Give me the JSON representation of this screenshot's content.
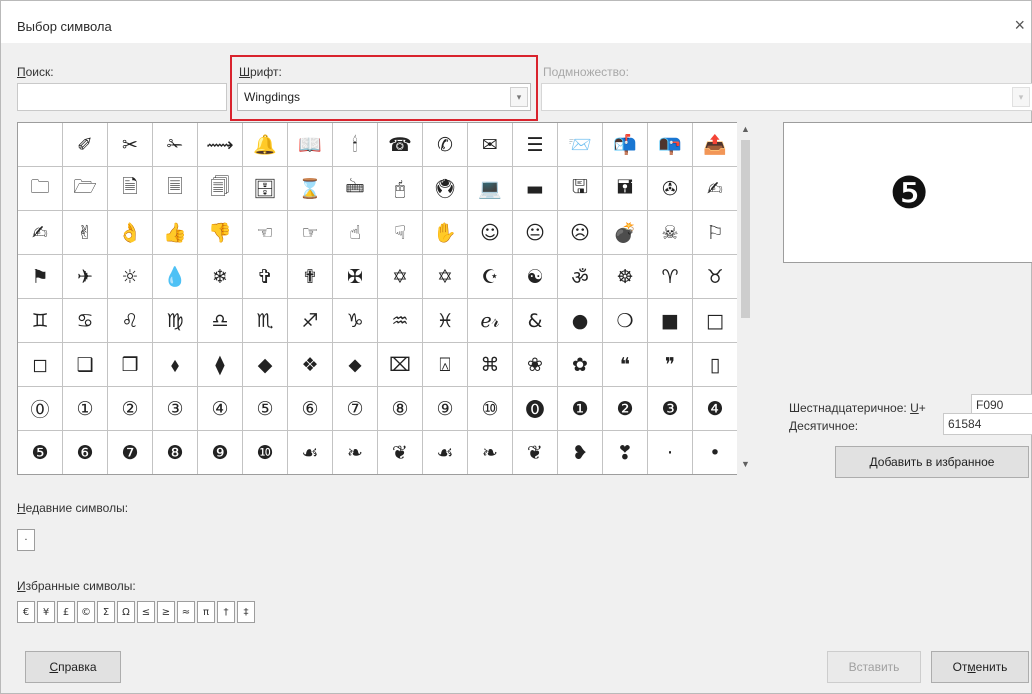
{
  "dialog": {
    "title": "Выбор символа",
    "close_glyph": "×"
  },
  "search": {
    "label_underlined": "П",
    "label_rest": "оиск:",
    "value": ""
  },
  "font": {
    "label_underlined": "Ш",
    "label_rest": "рифт:",
    "value": "Wingdings",
    "arrow": "▾"
  },
  "subset": {
    "label": "Подмножество:",
    "value": "",
    "arrow": "▾"
  },
  "grid": {
    "rows": [
      [
        " ",
        "✐",
        "✂",
        "✁",
        "⟿",
        "🔔",
        "📖",
        "🕯",
        "☎",
        "✆",
        "✉",
        "☰",
        "📨",
        "📬",
        "📭",
        "📤"
      ],
      [
        "🗀",
        "🗁",
        "🗎",
        "🗏",
        "🗐",
        "🗄",
        "⌛",
        "🖮",
        "🖰",
        "🖲",
        "💻",
        "▬",
        "🖫",
        "🖬",
        "✇",
        "✍"
      ],
      [
        "✍",
        "✌",
        "👌",
        "👍",
        "👎",
        "☜",
        "☞",
        "☝",
        "☟",
        "✋",
        "☺",
        "😐",
        "☹",
        "💣",
        "☠",
        "⚐"
      ],
      [
        "⚑",
        "✈",
        "☼",
        "💧",
        "❄",
        "✞",
        "✟",
        "✠",
        "✡",
        "✡",
        "☪",
        "☯",
        "ॐ",
        "☸",
        "♈",
        "♉"
      ],
      [
        "♊",
        "♋",
        "♌",
        "♍",
        "♎",
        "♏",
        "♐",
        "♑",
        "♒",
        "♓",
        "ℯ𝓇",
        "&",
        "●",
        "❍",
        "■",
        "□"
      ],
      [
        "◻",
        "❑",
        "❒",
        "⬧",
        "⧫",
        "◆",
        "❖",
        "⬥",
        "⌧",
        "⍓",
        "⌘",
        "❀",
        "✿",
        "❝",
        "❞",
        "▯"
      ],
      [
        "⓪",
        "①",
        "②",
        "③",
        "④",
        "⑤",
        "⑥",
        "⑦",
        "⑧",
        "⑨",
        "⑩",
        "⓿",
        "❶",
        "❷",
        "❸",
        "❹"
      ],
      [
        "❺",
        "❻",
        "❼",
        "❽",
        "❾",
        "❿",
        "☙",
        "❧",
        "❦",
        "☙",
        "❧",
        "❦",
        "❥",
        "❣",
        "·",
        "•"
      ]
    ]
  },
  "preview": {
    "glyph": "❺"
  },
  "hex": {
    "label_pre": "Шестнадцатеричное: ",
    "label_underlined": "U",
    "label_post": "+",
    "value": "F090"
  },
  "decimal": {
    "label_underlined": "Д",
    "label_rest": "есятичное:",
    "value": "61584"
  },
  "buttons": {
    "add_favorite": "Добавить в избранное",
    "help_underlined": "С",
    "help_rest": "правка",
    "insert": "Вставить",
    "cancel_pre": "От",
    "cancel_underlined": "м",
    "cancel_post": "енить"
  },
  "recent": {
    "label_underlined": "Н",
    "label_rest": "едавние символы:",
    "items": [
      "·"
    ]
  },
  "favorites": {
    "label_underlined": "И",
    "label_rest": "збранные символы:",
    "items": [
      "€",
      "¥",
      "£",
      "©",
      "Σ",
      "Ω",
      "≤",
      "≥",
      "≈",
      "π",
      "†",
      "‡"
    ]
  },
  "colors": {
    "highlight": "#d9232d"
  }
}
